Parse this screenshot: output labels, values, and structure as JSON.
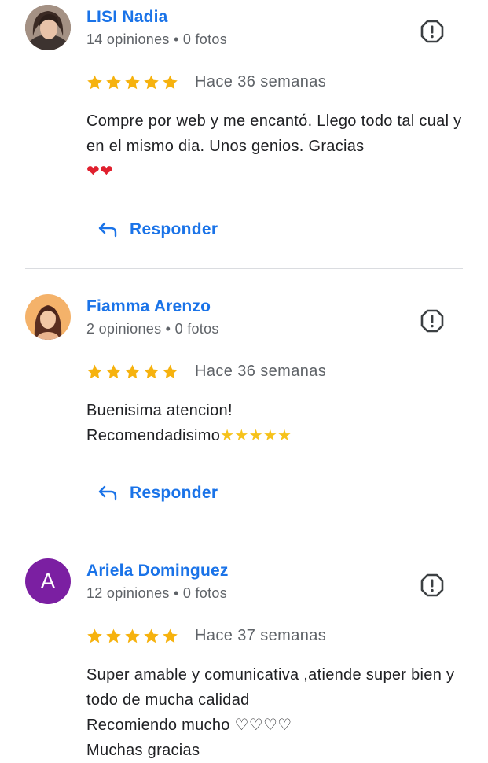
{
  "reviews": [
    {
      "name": "LISI Nadia",
      "meta": "14 opiniones • 0 fotos",
      "rating": 5,
      "time": "Hace 36 semanas",
      "text": "Compre por web y me encantó. Llego todo tal cual y en el mismo dia. Unos genios. Gracias",
      "text_emoji": "❤❤",
      "reply_label": "Responder",
      "avatar_icon": "user-photo-icon"
    },
    {
      "name": "Fiamma Arenzo",
      "meta": "2 opiniones • 0 fotos",
      "rating": 5,
      "time": "Hace 36 semanas",
      "text": "Buenisima atencion!\nRecomendadisimo",
      "text_emoji": "★★★★★",
      "reply_label": "Responder",
      "avatar_icon": "user-photo-icon"
    },
    {
      "name": "Ariela Dominguez",
      "meta": "12 opiniones • 0 fotos",
      "rating": 5,
      "time": "Hace 37 semanas",
      "text": "Super amable y comunicativa ,atiende super bien y todo de mucha calidad\nRecomiendo mucho ♡♡♡♡\nMuchas gracias",
      "avatar_letter": "A",
      "avatar_color": "#7b1fa2"
    }
  ],
  "colors": {
    "accent": "#1a73e8",
    "star": "#f6b20e",
    "muted": "#5f6368",
    "divider": "#dadce0"
  },
  "icons": {
    "report": "report-flag-icon",
    "reply": "reply-arrow-icon",
    "star": "star-icon"
  }
}
